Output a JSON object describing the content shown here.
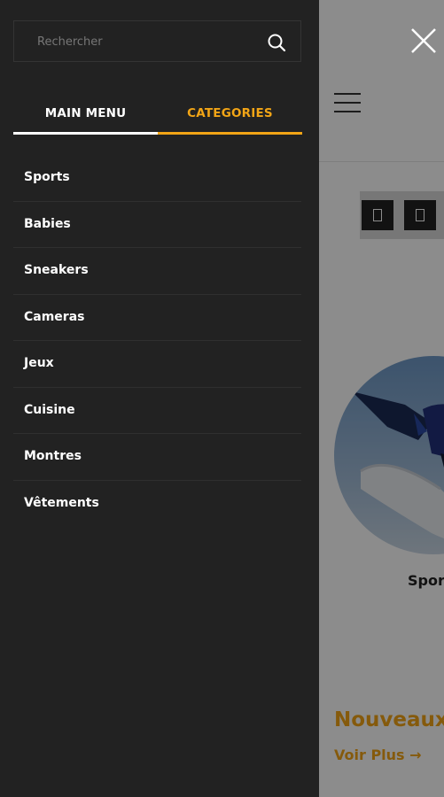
{
  "drawer": {
    "search": {
      "placeholder": "Rechercher",
      "value": ""
    },
    "tabs": [
      {
        "label": "MAIN MENU",
        "active_color": "#ffffff"
      },
      {
        "label": "CATEGORIES",
        "active_color": "#f2a516"
      }
    ],
    "categories": [
      {
        "label": "Sports"
      },
      {
        "label": "Babies"
      },
      {
        "label": "Sneakers"
      },
      {
        "label": "Cameras"
      },
      {
        "label": "Jeux"
      },
      {
        "label": "Cuisine"
      },
      {
        "label": "Montres"
      },
      {
        "label": "Vêtements"
      }
    ]
  },
  "background": {
    "category_label": "Spor",
    "section_title": "Nouveaux",
    "see_more": "Voir Plus →"
  },
  "colors": {
    "drawer_bg": "#222222",
    "accent": "#f2a516",
    "text_light": "#ffffff"
  },
  "icons": {
    "search": "search-icon",
    "close": "close-icon",
    "menu": "hamburger-menu-icon"
  }
}
